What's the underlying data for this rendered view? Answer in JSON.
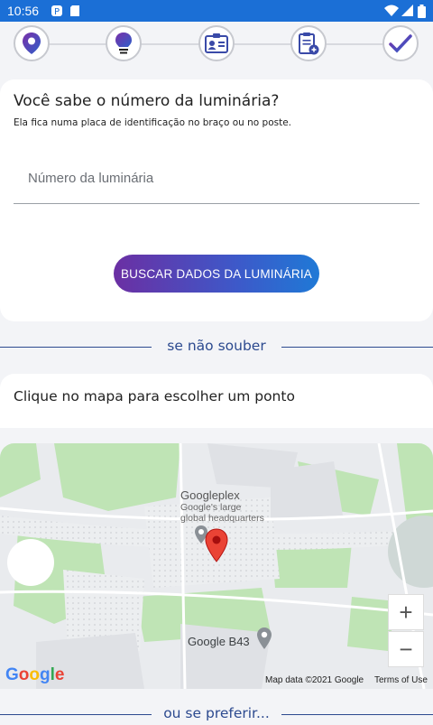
{
  "status_bar": {
    "time": "10:56"
  },
  "stepper": {
    "steps": [
      {
        "name": "location-pin-icon",
        "active": true
      },
      {
        "name": "lightbulb-icon",
        "active": true
      },
      {
        "name": "id-card-icon",
        "active": false
      },
      {
        "name": "clipboard-add-icon",
        "active": false
      },
      {
        "name": "checkmark-icon",
        "active": false
      }
    ]
  },
  "lamp_card": {
    "title": "Você sabe o número da luminária?",
    "subtitle": "Ela fica numa placa de identificação no braço ou no poste.",
    "input_placeholder": "Número da luminária",
    "input_value": "",
    "search_button": "BUSCAR DADOS DA LUMINÁRIA"
  },
  "divider1": "se não souber",
  "map_card": {
    "title": "Clique no mapa para escolher um ponto"
  },
  "map": {
    "place_name": "Googleplex",
    "place_desc_line1": "Google's large",
    "place_desc_line2": "global headquarters",
    "building_label": "Google B43",
    "zoom_in": "+",
    "zoom_out": "−",
    "map_data": "Map data ©2021 Google",
    "terms": "Terms of Use",
    "logo": "Google"
  },
  "divider2": "ou se preferir...",
  "colors": {
    "status_bar": "#1b6fd6",
    "accent_purple": "#6b2fa3",
    "accent_blue": "#1f79d6",
    "divider": "#2c4a8f"
  }
}
